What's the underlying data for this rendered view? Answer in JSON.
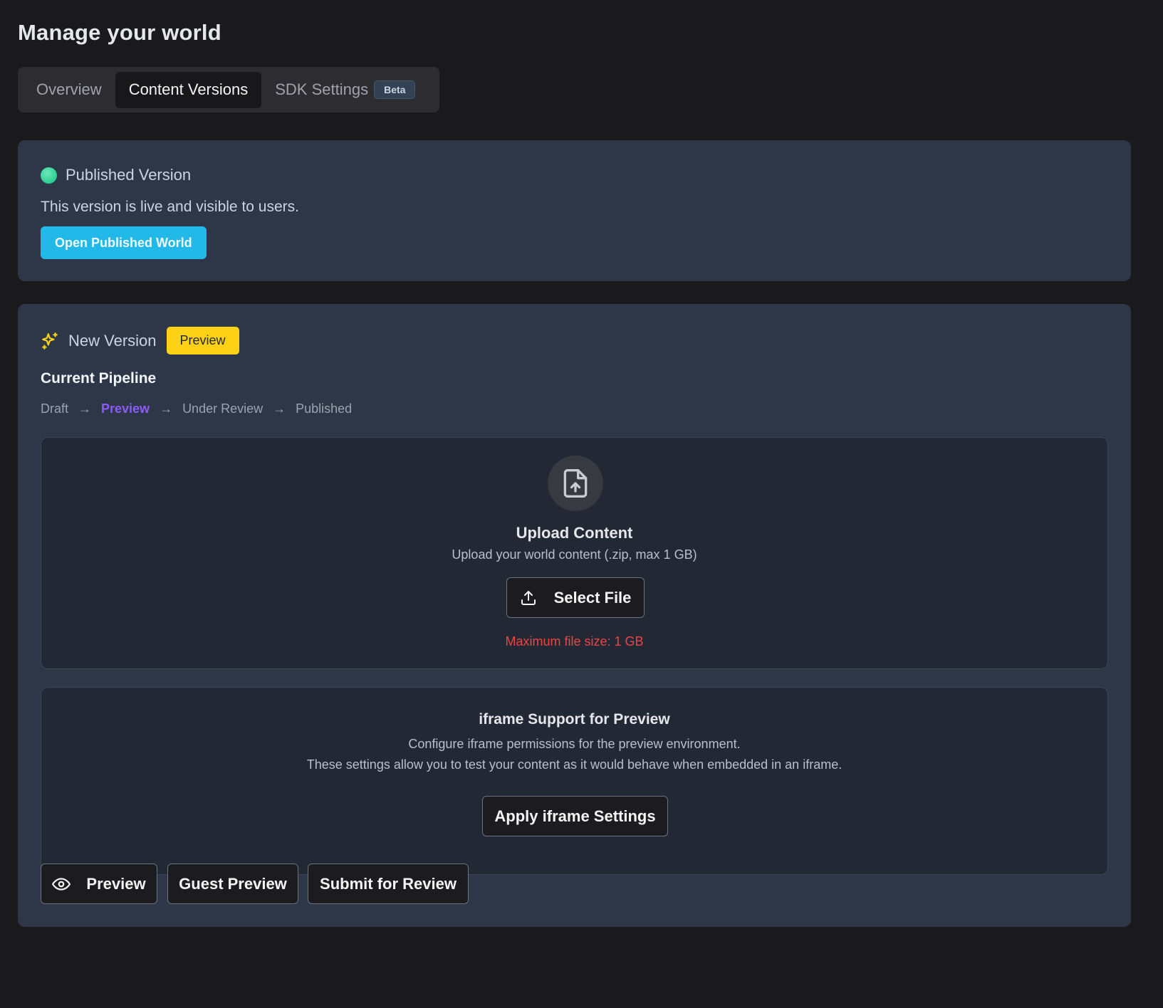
{
  "page": {
    "title": "Manage your world"
  },
  "tabs": [
    {
      "label": "Overview",
      "active": false
    },
    {
      "label": "Content Versions",
      "active": true
    },
    {
      "label": "SDK Settings",
      "active": false,
      "badge": "Beta"
    }
  ],
  "published": {
    "status_color": "#34d399",
    "title": "Published Version",
    "description": "This version is live and visible to users.",
    "open_button": "Open Published World"
  },
  "new_version": {
    "icon": "sparkles-icon",
    "title": "New Version",
    "badge": "Preview",
    "pipeline_title": "Current Pipeline",
    "pipeline": {
      "stages": [
        "Draft",
        "Preview",
        "Under Review",
        "Published"
      ],
      "current": "Preview",
      "separator": "→"
    },
    "upload": {
      "icon": "file-upload-icon",
      "title": "Upload Content",
      "description": "Upload your world content (.zip, max 1 GB)",
      "select_button": "Select File",
      "max_size_note": "Maximum file size: 1 GB"
    },
    "iframe": {
      "title": "iframe Support for Preview",
      "description_line1": "Configure iframe permissions for the preview environment.",
      "description_line2": "These settings allow you to test your content as it would behave when embedded in an iframe.",
      "apply_button": "Apply iframe Settings"
    },
    "actions": {
      "preview": "Preview",
      "guest_preview": "Guest Preview",
      "submit": "Submit for Review"
    }
  },
  "colors": {
    "background": "#1a1a1d",
    "card": "#2d3748",
    "accent_blue": "#22b8e8",
    "preview_badge": "#fcd116",
    "pipeline_current": "#8b5cf6",
    "warning_red": "#ef4444"
  }
}
